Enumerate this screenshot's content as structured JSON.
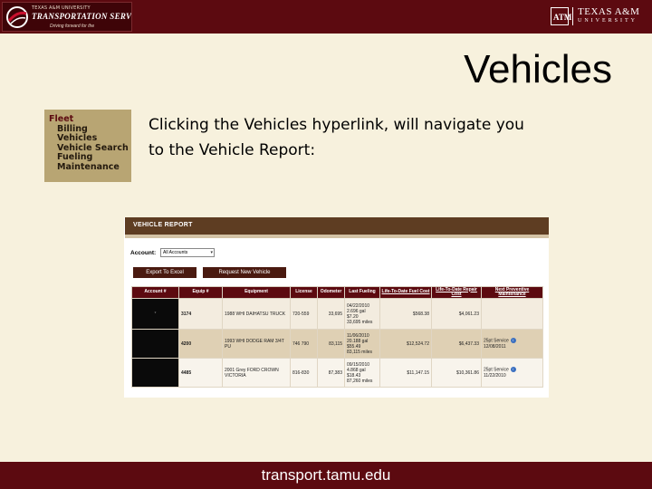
{
  "header": {
    "logo_line1": "TEXAS A&M UNIVERSITY",
    "logo_line2": "TRANSPORTATION SERVICES",
    "logo_line3": "Driving forward for the",
    "tam_mark": "ATM",
    "tam_name": "TEXAS A&M",
    "tam_university": "UNIVERSITY"
  },
  "title": "Vehicles",
  "nav_menu": {
    "items": [
      {
        "label": "Fleet"
      },
      {
        "label": "Billing"
      },
      {
        "label": "Vehicles"
      },
      {
        "label": "Vehicle Search"
      },
      {
        "label": "Fueling"
      },
      {
        "label": "Maintenance"
      }
    ]
  },
  "description": "Clicking the Vehicles hyperlink, will navigate you to the Vehicle Report:",
  "report": {
    "title": "VEHICLE REPORT",
    "account_label": "Account:",
    "account_value": "All Accounts",
    "export_button": "Export To Excel",
    "request_button": "Request New Vehicle",
    "columns": [
      "Account #",
      "Equip #",
      "Equipment",
      "License",
      "Odometer",
      "Last Fueling",
      "Life-To-Date Fuel Cost",
      "Life-To-Date Repair Cost",
      "Next Preventive Maintenance"
    ],
    "rows": [
      {
        "account": "*",
        "equip": "3174",
        "equipment": "1988 WHI DAIHATSU TRUCK",
        "license": "720-559",
        "odometer": "33,695",
        "fuel_date": "04/22/2010",
        "fuel_gal": "2.696 gal",
        "fuel_cost": "$7.20",
        "fuel_miles": "33,695 miles",
        "fuel_total": "$568.38",
        "repair_total": "$4,061.23",
        "pm": "",
        "pm_date": ""
      },
      {
        "account": "",
        "equip": "4200",
        "equipment": "1993 WHI DODGE RAM 3/4T PU",
        "license": "746 790",
        "odometer": "83,115",
        "fuel_date": "11/06/2010",
        "fuel_gal": "20.188 gal",
        "fuel_cost": "$55.49",
        "fuel_miles": "83,115 miles",
        "fuel_total": "$12,524.72",
        "repair_total": "$6,437.33",
        "pm": "25pt Service",
        "pm_date": "12/08/2011"
      },
      {
        "account": "",
        "equip": "4485",
        "equipment": "2001 Grey FORD CROWN VICTORIA",
        "license": "816-830",
        "odometer": "87,383",
        "fuel_date": "09/15/2010",
        "fuel_gal": "4.868 gal",
        "fuel_cost": "$18.43",
        "fuel_miles": "87,260 miles",
        "fuel_total": "$11,147.15",
        "repair_total": "$10,361.86",
        "pm": "25pt Service",
        "pm_date": "11/22/2010"
      }
    ]
  },
  "footer": "transport.tamu.edu",
  "colors": {
    "maroon": "#5c0a10",
    "background": "#f7f1dd",
    "report_header": "#5e3d22",
    "nav_bg": "#b8a573"
  },
  "icons": {
    "logo": "swoosh-logo-icon",
    "info": "info-icon"
  }
}
